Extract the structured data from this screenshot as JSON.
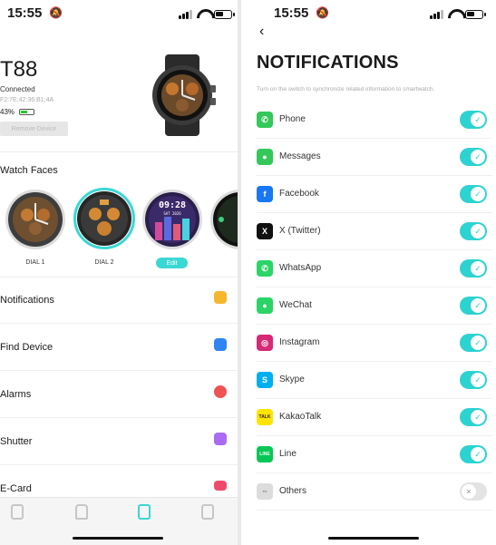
{
  "left": {
    "status": {
      "time": "15:55"
    },
    "device": {
      "name": "T88",
      "status": "Connected",
      "mac": "F2:7E:42:36:B1:4A",
      "battery": "43%",
      "remove_label": "Remove Device"
    },
    "watch_faces": {
      "title": "Watch Faces",
      "dials": [
        {
          "label": "DIAL 1"
        },
        {
          "label": "DIAL 2"
        },
        {
          "time_text": "09:28",
          "date_text": "SAT 2026"
        }
      ],
      "edit_label": "Edit"
    },
    "menu": [
      {
        "label": "Notifications",
        "icon": "chat-icon",
        "color": "#f6b62e"
      },
      {
        "label": "Find Device",
        "icon": "watch-icon",
        "color": "#2f85f2"
      },
      {
        "label": "Alarms",
        "icon": "clock-icon",
        "color": "#ef5353"
      },
      {
        "label": "Shutter",
        "icon": "camera-icon",
        "color": "#a86cf5"
      },
      {
        "label": "E-Card",
        "icon": "card-icon",
        "color": "#ef4a6c"
      }
    ],
    "tabs": [
      {
        "icon": "device-tab-icon"
      },
      {
        "icon": "activity-tab-icon"
      },
      {
        "icon": "watch-tab-icon",
        "active": true
      },
      {
        "icon": "profile-tab-icon"
      }
    ],
    "accent": "#3bd7d3"
  },
  "right": {
    "status": {
      "time": "15:55"
    },
    "title": "NOTIFICATIONS",
    "description": "Turn on the switch to synchronize related information to smartwatch.",
    "apps": [
      {
        "name": "Phone",
        "icon": "phone-icon",
        "color": "#34c759",
        "glyph": "✆",
        "enabled": true
      },
      {
        "name": "Messages",
        "icon": "messages-icon",
        "color": "#34c759",
        "glyph": "●",
        "enabled": true
      },
      {
        "name": "Facebook",
        "icon": "facebook-icon",
        "color": "#1877f2",
        "glyph": "f",
        "enabled": true
      },
      {
        "name": "X (Twitter)",
        "icon": "x-icon",
        "color": "#111111",
        "glyph": "X",
        "enabled": true
      },
      {
        "name": "WhatsApp",
        "icon": "whatsapp-icon",
        "color": "#2bd466",
        "glyph": "✆",
        "enabled": true
      },
      {
        "name": "WeChat",
        "icon": "wechat-icon",
        "color": "#2bd466",
        "glyph": "●",
        "enabled": true
      },
      {
        "name": "Instagram",
        "icon": "instagram-icon",
        "color": "#d62976",
        "glyph": "◎",
        "enabled": true
      },
      {
        "name": "Skype",
        "icon": "skype-icon",
        "color": "#00aff0",
        "glyph": "S",
        "enabled": true
      },
      {
        "name": "KakaoTalk",
        "icon": "kakaotalk-icon",
        "color": "#fee500",
        "glyph": "TALK",
        "enabled": true
      },
      {
        "name": "Line",
        "icon": "line-icon",
        "color": "#06c755",
        "glyph": "LINE",
        "enabled": true
      },
      {
        "name": "Others",
        "icon": "grid-icon",
        "color": "#dcdcdc",
        "glyph": "▪▪",
        "enabled": false
      }
    ],
    "toggle_on_color": "#2dd3d0"
  }
}
